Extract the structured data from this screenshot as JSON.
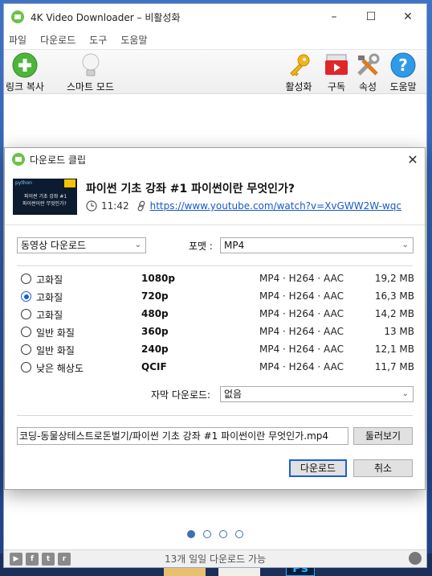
{
  "window": {
    "title": "4K Video Downloader – 비활성화",
    "minimize": "–",
    "maximize": "☐",
    "close": "✕"
  },
  "menu": [
    "파일",
    "다운로드",
    "도구",
    "도움말"
  ],
  "toolbar": {
    "paste_link": "링크 복사",
    "smart_mode": "스마트 모드",
    "activate": "활성화",
    "subscribe": "구독",
    "preferences": "속성",
    "help": "도움말"
  },
  "dialog": {
    "title": "다운로드 클립",
    "close": "✕",
    "video": {
      "title": "파이썬 기초 강좌 #1 파이썬이란 무엇인가?",
      "duration": "11:42",
      "url": "https://www.youtube.com/watch?v=XvGWW2W-wqc",
      "thumbnail": {
        "tag": "python",
        "line1": "파이썬 기초 강좌 #1",
        "line2": "파이썬이란 무엇인가?"
      }
    },
    "download_type": "동영상 다운로드",
    "format_label": "포맷 :",
    "format_value": "MP4",
    "qualities": [
      {
        "label": "고화질",
        "resolution": "1080p",
        "format": "MP4 · H264 · AAC",
        "size": "19,2 MB",
        "selected": false
      },
      {
        "label": "고화질",
        "resolution": "720p",
        "format": "MP4 · H264 · AAC",
        "size": "16,3 MB",
        "selected": true
      },
      {
        "label": "고화질",
        "resolution": "480p",
        "format": "MP4 · H264 · AAC",
        "size": "14,2 MB",
        "selected": false
      },
      {
        "label": "일반 화질",
        "resolution": "360p",
        "format": "MP4 · H264 · AAC",
        "size": "13 MB",
        "selected": false
      },
      {
        "label": "일반 화질",
        "resolution": "240p",
        "format": "MP4 · H264 · AAC",
        "size": "12,1 MB",
        "selected": false
      },
      {
        "label": "낮은 해상도",
        "resolution": "QCIF",
        "format": "MP4 · H264 · AAC",
        "size": "11,7 MB",
        "selected": false
      }
    ],
    "subtitles_label": "자막 다운로드:",
    "subtitles_value": "없음",
    "save_path": "코딩-동물상테스트로돈벌기/파이썬 기초 강좌 #1 파이썬이란 무엇인가.mp4",
    "browse": "둘러보기",
    "download": "다운로드",
    "cancel": "취소"
  },
  "status": {
    "text": "13개 일일 다운로드 가능",
    "social": [
      "You Tube",
      "f",
      "t",
      "r"
    ]
  },
  "pagination": {
    "total": 4,
    "active": 1
  },
  "colors": {
    "accent": "#1a5fd0",
    "app_green": "#6cc24a",
    "link": "#1a57c8"
  }
}
